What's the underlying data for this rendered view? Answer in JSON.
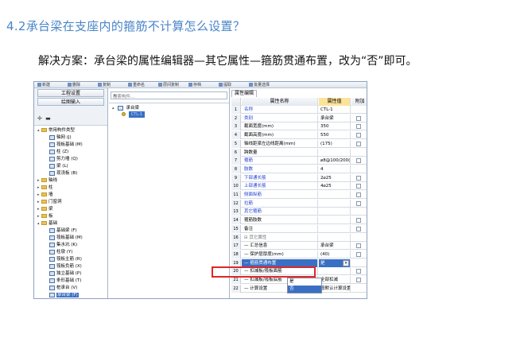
{
  "heading": "4.2承台梁在支座内的箍筋不计算怎么设置？",
  "solution": "解决方案：承台梁的属性编辑器—其它属性—箍筋贯通布置，改为“否”即可。",
  "screenshot": {
    "toolbar": [
      "新建",
      "删除",
      "复制",
      "重命名",
      "层间复制",
      "存档",
      "提取",
      "批量选择"
    ],
    "left_panel": {
      "buttons": [
        "工程设置",
        "绘图输入"
      ],
      "tools": "✢ ▬",
      "tree": [
        {
          "label": "常用构件类型",
          "level": 1,
          "type": "folder",
          "expanded": true
        },
        {
          "label": "轴网 (J)",
          "level": 2,
          "type": "item"
        },
        {
          "label": "筏板基础 (M)",
          "level": 2,
          "type": "item"
        },
        {
          "label": "柱 (Z)",
          "level": 2,
          "type": "item"
        },
        {
          "label": "剪力墙 (Q)",
          "level": 2,
          "type": "item"
        },
        {
          "label": "梁 (L)",
          "level": 2,
          "type": "item"
        },
        {
          "label": "现浇板 (B)",
          "level": 2,
          "type": "item"
        },
        {
          "label": "轴线",
          "level": 1,
          "type": "folder"
        },
        {
          "label": "柱",
          "level": 1,
          "type": "folder"
        },
        {
          "label": "墙",
          "level": 1,
          "type": "folder"
        },
        {
          "label": "门窗洞",
          "level": 1,
          "type": "folder"
        },
        {
          "label": "梁",
          "level": 1,
          "type": "folder"
        },
        {
          "label": "板",
          "level": 1,
          "type": "folder"
        },
        {
          "label": "基础",
          "level": 1,
          "type": "folder",
          "expanded": true
        },
        {
          "label": "基础梁 (F)",
          "level": 2,
          "type": "item"
        },
        {
          "label": "筏板基础 (M)",
          "level": 2,
          "type": "item"
        },
        {
          "label": "集水坑 (K)",
          "level": 2,
          "type": "item"
        },
        {
          "label": "柱墩 (Y)",
          "level": 2,
          "type": "item"
        },
        {
          "label": "筏板主筋 (R)",
          "level": 2,
          "type": "item"
        },
        {
          "label": "筏板负筋 (X)",
          "level": 2,
          "type": "item"
        },
        {
          "label": "独立基础 (P)",
          "level": 2,
          "type": "item"
        },
        {
          "label": "条形基础 (T)",
          "level": 2,
          "type": "item"
        },
        {
          "label": "桩承台 (V)",
          "level": 2,
          "type": "item"
        },
        {
          "label": "承台梁 (F)",
          "level": 2,
          "type": "item",
          "selected": true
        }
      ]
    },
    "middle_panel": {
      "search_placeholder": "搜索构件...",
      "root": "承台梁",
      "child": "CTL-1"
    },
    "right_panel": {
      "tab": "属性编辑",
      "headers": [
        "属性名称",
        "属性值",
        "附加"
      ],
      "rows": [
        {
          "n": "1",
          "name": "名称",
          "value": "CTL-1",
          "blue": true,
          "check": false
        },
        {
          "n": "2",
          "name": "类别",
          "value": "承台梁",
          "blue": true,
          "check": true
        },
        {
          "n": "3",
          "name": "截面宽度(mm)",
          "value": "350",
          "blue": false,
          "check": true
        },
        {
          "n": "4",
          "name": "截面高度(mm)",
          "value": "550",
          "blue": false,
          "check": true
        },
        {
          "n": "5",
          "name": "轴线距梁左边线距离(mm)",
          "value": "(175)",
          "blue": false,
          "check": true
        },
        {
          "n": "6",
          "name": "跨数量",
          "value": "",
          "blue": false,
          "check": false
        },
        {
          "n": "7",
          "name": "箍筋",
          "value": "⌀8@100/200(4)",
          "blue": true,
          "check": true
        },
        {
          "n": "8",
          "name": "肢数",
          "value": "4",
          "blue": true,
          "check": false
        },
        {
          "n": "9",
          "name": "下部通长筋",
          "value": "2⌀25",
          "blue": true,
          "check": true
        },
        {
          "n": "10",
          "name": "上部通长筋",
          "value": "4⌀25",
          "blue": true,
          "check": true
        },
        {
          "n": "11",
          "name": "侧面纵筋",
          "value": "",
          "blue": true,
          "check": true
        },
        {
          "n": "12",
          "name": "拉筋",
          "value": "",
          "blue": true,
          "check": true
        },
        {
          "n": "13",
          "name": "其它箍筋",
          "value": "",
          "blue": true,
          "check": false
        },
        {
          "n": "14",
          "name": "箍筋肢数",
          "value": "",
          "blue": false,
          "check": true
        },
        {
          "n": "15",
          "name": "备注",
          "value": "",
          "blue": false,
          "check": true
        },
        {
          "n": "16",
          "name": "⊟ 其它属性",
          "value": "",
          "blue": false,
          "check": false,
          "group": true
        },
        {
          "n": "17",
          "name": "— 汇总信息",
          "value": "承台梁",
          "blue": false,
          "check": true
        },
        {
          "n": "18",
          "name": "— 保护层厚度(mm)",
          "value": "(40)",
          "blue": false,
          "check": true
        },
        {
          "n": "19",
          "name": "— 箍筋贯通布置",
          "value": "是",
          "blue": false,
          "check": false,
          "highlight": true
        },
        {
          "n": "20",
          "name": "— 扣减板/筏板面筋",
          "value": "",
          "blue": false,
          "check": true
        },
        {
          "n": "21",
          "name": "— 扣减板/筏板底筋",
          "value": "全部扣减",
          "blue": false,
          "check": true
        },
        {
          "n": "22",
          "name": "— 计算设置",
          "value": "按默认计算设置计算",
          "blue": false,
          "check": false
        }
      ],
      "dropdown_options": [
        "是",
        "否"
      ]
    }
  }
}
